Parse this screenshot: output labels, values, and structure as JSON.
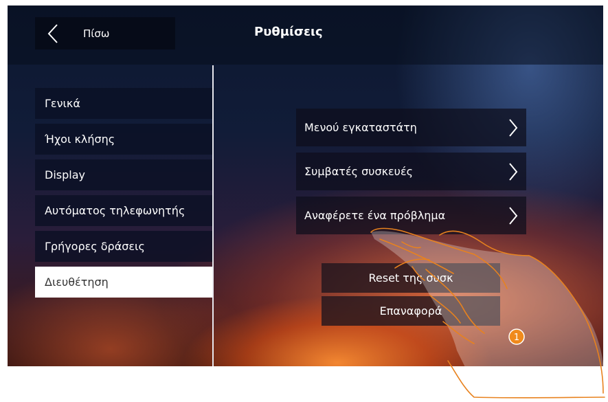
{
  "header": {
    "back_label": "Πίσω",
    "title": "Ρυθμίσεις"
  },
  "sidebar": {
    "items": [
      {
        "label": "Γενικά",
        "active": false
      },
      {
        "label": "Ήχοι κλήσης",
        "active": false
      },
      {
        "label": "Display",
        "active": false
      },
      {
        "label": "Αυτόματος τηλεφωνητής",
        "active": false
      },
      {
        "label": "Γρήγορες δράσεις",
        "active": false
      },
      {
        "label": "Διευθέτηση",
        "active": true
      }
    ]
  },
  "main": {
    "options": [
      {
        "label": "Μενού εγκαταστάτη",
        "icon": "chevron-right-icon"
      },
      {
        "label": "Συμβατές συσκευές",
        "icon": "chevron-right-icon"
      },
      {
        "label": "Αναφέρετε ένα πρόβλημα",
        "icon": "chevron-right-icon"
      }
    ],
    "actions": [
      {
        "label": "Reset της συσκ"
      },
      {
        "label": "Επαναφορά"
      }
    ]
  },
  "callout": {
    "number": "1",
    "color": "#f08a1c"
  },
  "colors": {
    "active_item_bg": "#ffffff",
    "hand_outline": "#e8821e"
  }
}
